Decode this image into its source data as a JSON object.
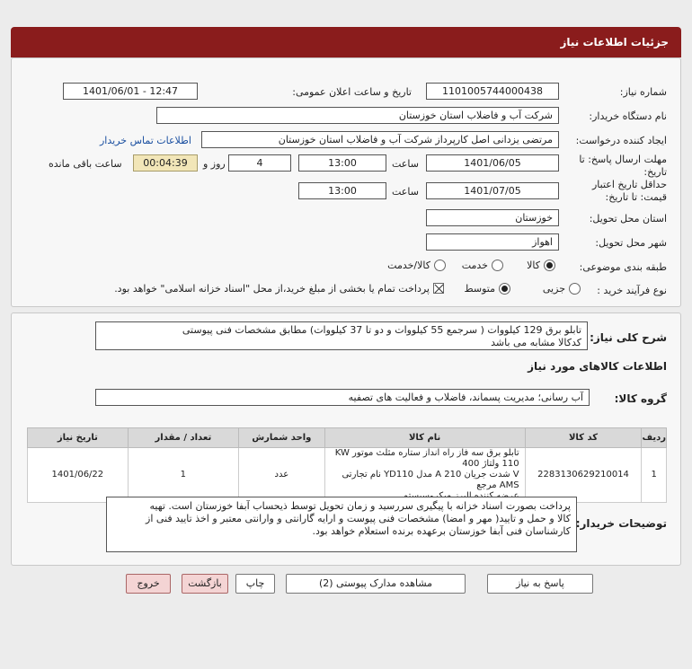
{
  "header": {
    "title": "جزئیات اطلاعات نیاز"
  },
  "form": {
    "need_number_label": "شماره نیاز:",
    "need_number": "1101005744000438",
    "announce_label": "تاریخ و ساعت اعلان عمومی:",
    "announce_value": "1401/06/01 - 12:47",
    "buyer_org_label": "نام دستگاه خریدار:",
    "buyer_org": "شرکت آب و فاضلاب استان خوزستان",
    "creator_label": "ایجاد کننده درخواست:",
    "creator": "مرتضی یزدانی اصل کارپرداز شرکت آب و فاضلاب استان خوزستان",
    "contact_link": "اطلاعات تماس خریدار",
    "deadline_label_1": "مهلت ارسال پاسخ: تا",
    "deadline_label_2": "تاریخ:",
    "deadline_date": "1401/06/05",
    "time_label": "ساعت",
    "deadline_time": "13:00",
    "days_value": "4",
    "days_label": "روز و",
    "remaining_value": "00:04:39",
    "remaining_label": "ساعت باقی مانده",
    "validity_label_1": "حداقل تاریخ اعتبار",
    "validity_label_2": "قیمت: تا تاریخ:",
    "validity_date": "1401/07/05",
    "validity_time_label": "ساعت",
    "validity_time": "13:00",
    "province_label": "استان محل تحویل:",
    "province": "خوزستان",
    "city_label": "شهر محل تحویل:",
    "city": "اهواز",
    "category_label": "طبقه بندی موضوعی:",
    "category_options": [
      "کالا",
      "خدمت",
      "کالا/خدمت"
    ],
    "process_label": "نوع فرآیند خرید :",
    "process_options": [
      "جزیی",
      "متوسط"
    ],
    "payment_note": "پرداخت تمام یا بخشی از مبلغ خرید،از محل \"اسناد خزانه اسلامی\" خواهد بود."
  },
  "description": {
    "label": "شرح کلی نیاز:",
    "text_line1": "تابلو برق 129 کیلووات ( سرجمع 55 کیلووات و دو تا 37 کیلووات) مطابق مشخصات فنی پیوستی",
    "text_line2": "کدکالا مشابه می باشد"
  },
  "goods": {
    "section_title": "اطلاعات کالاهای مورد نیاز",
    "group_label": "گروه کالا:",
    "group_value": "آب رسانی؛ مدیریت پسماند، فاضلاب و فعالیت های تصفیه",
    "columns": [
      "ردیف",
      "کد کالا",
      "نام کالا",
      "واحد شمارش",
      "تعداد / مقدار",
      "تاریخ نیاز"
    ],
    "rows": [
      {
        "row": "1",
        "code": "2283130629210014",
        "name_line1": "تابلو برق سه فاز راه انداز ستاره مثلث موتور KW 110 ولتاژ 400",
        "name_line2": "V شدت جریان A 210 مدل YD110 نام تجارتی AMS مرجع",
        "name_line3": "عرضه کننده البرز میکروسیستم",
        "unit": "عدد",
        "qty": "1",
        "date": "1401/06/22"
      }
    ]
  },
  "buyer_notes": {
    "label": "توضیحات خریدار:",
    "line1": "پرداخت بصورت اسناد خزانه با پیگیری سررسید و زمان تحویل توسط ذیحساب آبفا خوزستان است. تهیه",
    "line2": "کالا و حمل و تایید( مهر و امضا) مشخصات فنی پیوست و ارایه گارانتی و وارانتی معتبر و اخذ تایید فنی از",
    "line3": "کارشناسان فنی آبفا خوزستان برعهده برنده استعلام خواهد بود."
  },
  "buttons": {
    "reply": "پاسخ به نیاز",
    "view_docs": "مشاهده مدارک پیوستی (2)",
    "print": "چاپ",
    "back": "بازگشت",
    "exit": "خروج"
  }
}
